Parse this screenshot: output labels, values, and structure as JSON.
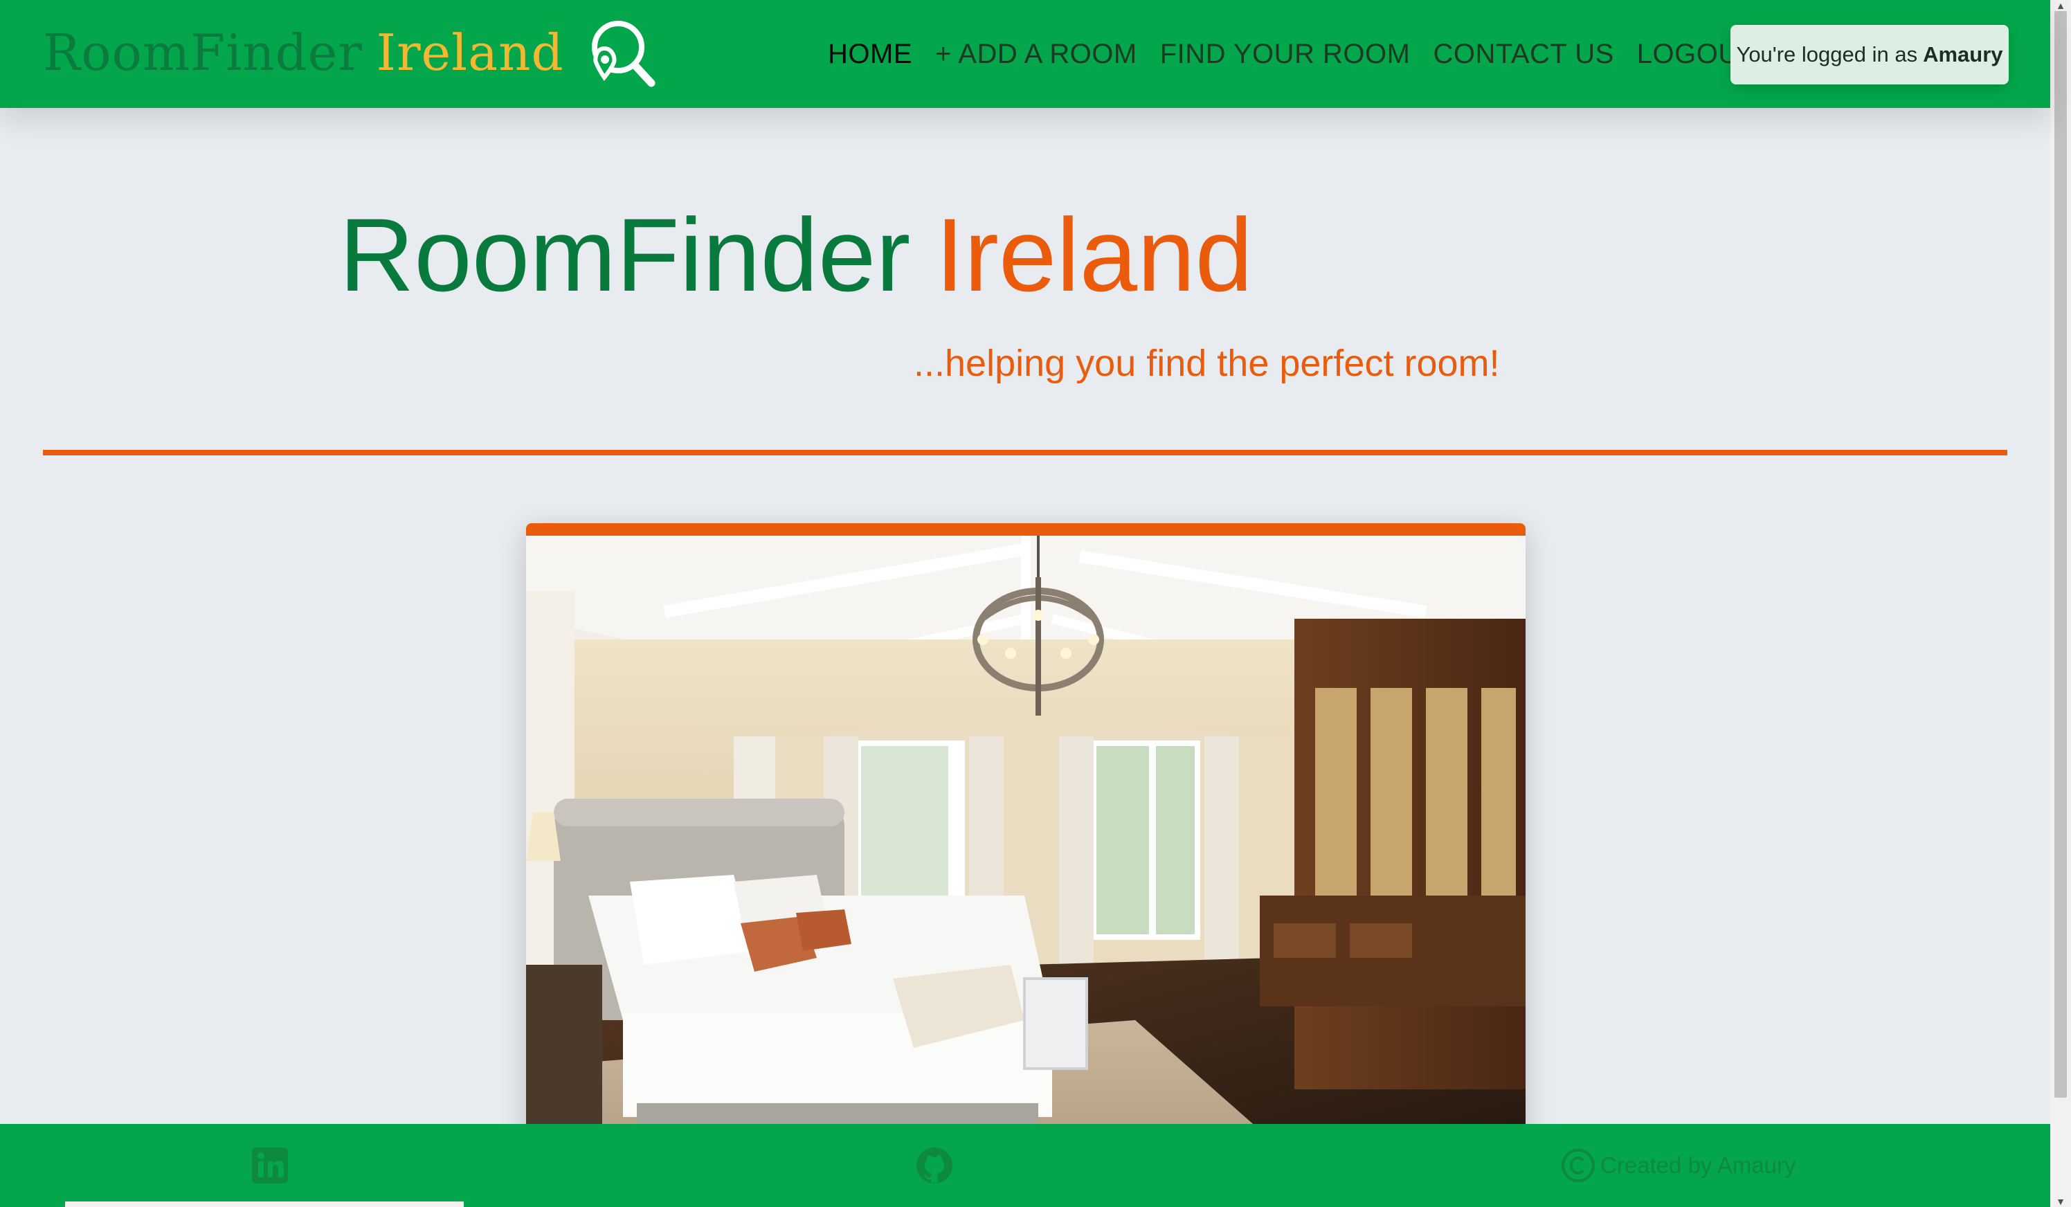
{
  "brand": {
    "name_part1": "RoomFinder",
    "name_part2": "Ireland",
    "logo_icon": "map-pin-search-icon"
  },
  "nav": {
    "home": "HOME",
    "add_room": "+ ADD A ROOM",
    "find_room": "FIND YOUR ROOM",
    "contact": "CONTACT US",
    "logout": "LOGOUT"
  },
  "login_badge": {
    "prefix": "You're logged in as",
    "username": "Amaury"
  },
  "hero": {
    "title_part1": "RoomFinder",
    "title_part2": "Ireland",
    "tagline": "...helping you find the perfect room!"
  },
  "card": {
    "image_alt": "bedroom-photo"
  },
  "footer": {
    "linkedin_icon": "linkedin-icon",
    "github_icon": "github-icon",
    "credit": "Created by Amaury"
  },
  "colors": {
    "nav_green": "#03a64a",
    "dark_green": "#087a3d",
    "orange": "#ea5b0c",
    "gold": "#f4b731",
    "background": "#e8ebef"
  }
}
